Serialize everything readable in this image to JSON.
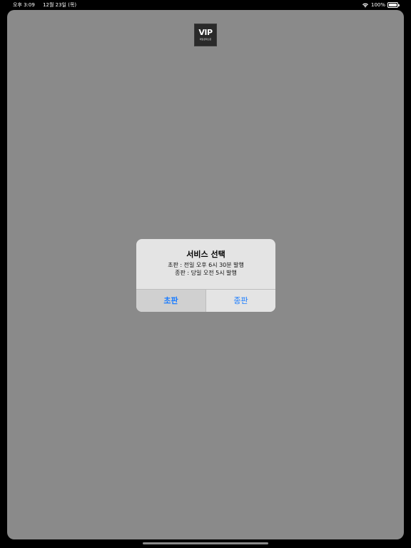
{
  "status_bar": {
    "time": "오후 3:09",
    "date": "12월 23일 (목)",
    "battery": "100%",
    "icons": [
      "wifi-icon",
      "battery-icon"
    ]
  },
  "logo": {
    "text": "VIP",
    "subtext": "매일경제신문"
  },
  "dialog": {
    "title": "서비스 선택",
    "message_line1": "초판 : 전일 오후 6시 30분 발행",
    "message_line2": "종판 : 당일 오전 5시 발행",
    "button_left": "초판",
    "button_right": "종판"
  },
  "colors": {
    "background_dim": "#8a8a8a",
    "dialog_bg": "#e4e4e4",
    "button_text": "#1a7cff"
  }
}
